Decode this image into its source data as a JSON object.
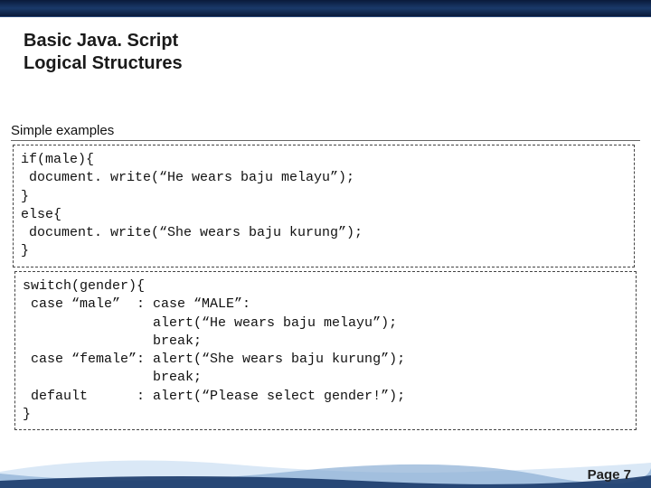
{
  "title": {
    "line1": "Basic Java. Script",
    "line2": "Logical Structures"
  },
  "subtitle": "Simple examples",
  "code_boxes": [
    "if(male){\n document. write(“He wears baju melayu”);\n}\nelse{\n document. write(“She wears baju kurung”);\n}",
    "switch(gender){\n case “male”  : case “MALE”:\n                alert(“He wears baju melayu”);\n                break;\n case “female”: alert(“She wears baju kurung”);\n                break;\n default      : alert(“Please select gender!”);\n}"
  ],
  "page_label": "Page 7"
}
